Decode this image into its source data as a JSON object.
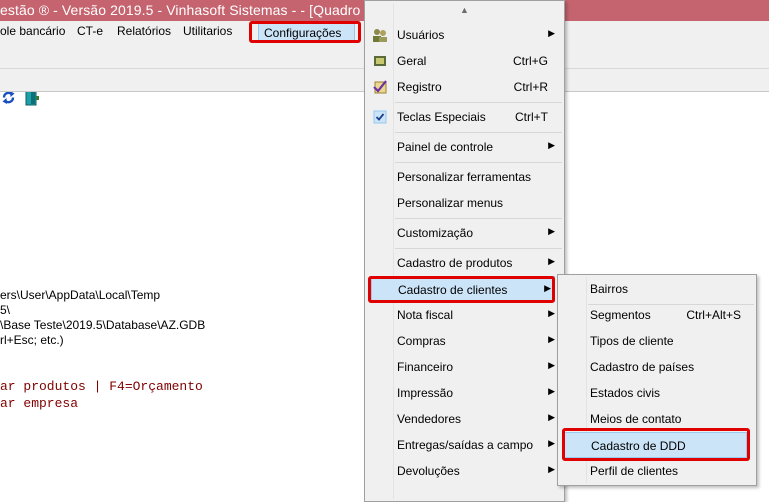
{
  "window": {
    "title": "estão ® - Versão 2019.5 - Vinhasoft Sistemas -  - [Quadro"
  },
  "menubar": {
    "items": [
      "ole bancário",
      "CT-e",
      "Relatórios",
      "Utilitarios"
    ],
    "active": "Configurações"
  },
  "info_lines": [
    "ers\\User\\AppData\\Local\\Temp",
    "5\\",
    "\\Base Teste\\2019.5\\Database\\AZ.GDB",
    "rl+Esc; etc.)"
  ],
  "hotkey_lines": [
    "ar produtos | F4=Orçamento",
    "ar empresa"
  ],
  "config_menu": {
    "items": [
      {
        "label": "Usuários",
        "shortcut": "",
        "submenu": true,
        "icon": "users-icon"
      },
      {
        "label": "Geral",
        "shortcut": "Ctrl+G",
        "submenu": false,
        "icon": "settings-icon"
      },
      {
        "label": "Registro",
        "shortcut": "Ctrl+R",
        "submenu": false,
        "icon": "registration-icon"
      },
      {
        "label": "Teclas Especiais",
        "shortcut": "Ctrl+T",
        "submenu": false,
        "icon": "checkmark-icon",
        "checked": true
      },
      {
        "label": "Painel de controle",
        "shortcut": "",
        "submenu": true
      },
      {
        "label": "Personalizar ferramentas",
        "shortcut": "",
        "submenu": false
      },
      {
        "label": "Personalizar menus",
        "shortcut": "",
        "submenu": false
      },
      {
        "label": "Customização",
        "shortcut": "",
        "submenu": true
      },
      {
        "label": "Cadastro de produtos",
        "shortcut": "",
        "submenu": true
      },
      {
        "label": "Cadastro de clientes",
        "shortcut": "",
        "submenu": true,
        "selected": true
      },
      {
        "label": "Nota fiscal",
        "shortcut": "",
        "submenu": true
      },
      {
        "label": "Compras",
        "shortcut": "",
        "submenu": true
      },
      {
        "label": "Financeiro",
        "shortcut": "",
        "submenu": true
      },
      {
        "label": "Impressão",
        "shortcut": "",
        "submenu": true
      },
      {
        "label": "Vendedores",
        "shortcut": "",
        "submenu": true
      },
      {
        "label": "Entregas/saídas a campo",
        "shortcut": "",
        "submenu": true
      },
      {
        "label": "Devoluções",
        "shortcut": "",
        "submenu": true
      }
    ]
  },
  "clientes_submenu": {
    "items": [
      {
        "label": "Bairros",
        "shortcut": ""
      },
      {
        "label": "Segmentos",
        "shortcut": "Ctrl+Alt+S"
      },
      {
        "label": "Tipos de cliente",
        "shortcut": ""
      },
      {
        "label": "Cadastro de países",
        "shortcut": ""
      },
      {
        "label": "Estados civis",
        "shortcut": ""
      },
      {
        "label": "Meios de contato",
        "shortcut": ""
      },
      {
        "label": "Cadastro de DDD",
        "shortcut": "",
        "selected": true
      },
      {
        "label": "Perfil de clientes",
        "shortcut": ""
      }
    ]
  },
  "colors": {
    "titlebar": "#c5636f",
    "highlight": "#cce4f7",
    "annotation_red": "#e00000",
    "hotkey_text": "#800000"
  }
}
